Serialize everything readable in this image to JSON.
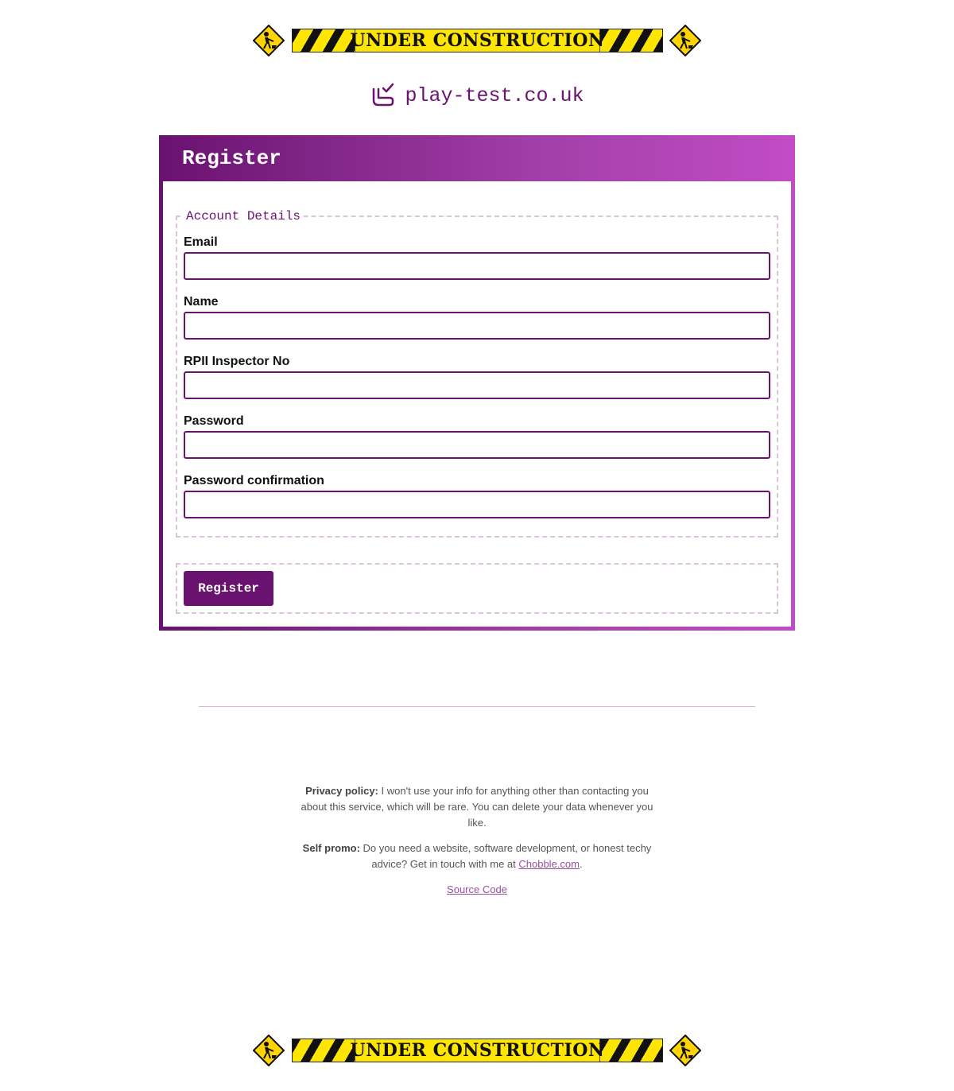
{
  "banner": {
    "text": "UNDER CONSTRUCTION"
  },
  "brand": {
    "name": "play-test.co.uk",
    "icon": "seat-check-icon"
  },
  "card": {
    "title": "Register"
  },
  "fieldset": {
    "legend": "Account Details",
    "fields": [
      {
        "label": "Email",
        "value": ""
      },
      {
        "label": "Name",
        "value": ""
      },
      {
        "label": "RPII Inspector No",
        "value": ""
      },
      {
        "label": "Password",
        "value": ""
      },
      {
        "label": "Password confirmation",
        "value": ""
      }
    ]
  },
  "actions": {
    "submit_label": "Register"
  },
  "footer": {
    "privacy_label": "Privacy policy:",
    "privacy_text": "I won't use your info for anything other than contacting you about this service, which will be rare. You can delete your data whenever you like.",
    "promo_label": "Self promo:",
    "promo_text": "Do you need a website, software development, or honest techy advice? Get in touch with me at",
    "promo_link": "Chobble.com",
    "promo_end": ".",
    "source_link": "Source Code"
  },
  "colors": {
    "brand": "#6a1270",
    "accent": "#c24cc6",
    "warning": "#ffe600"
  }
}
